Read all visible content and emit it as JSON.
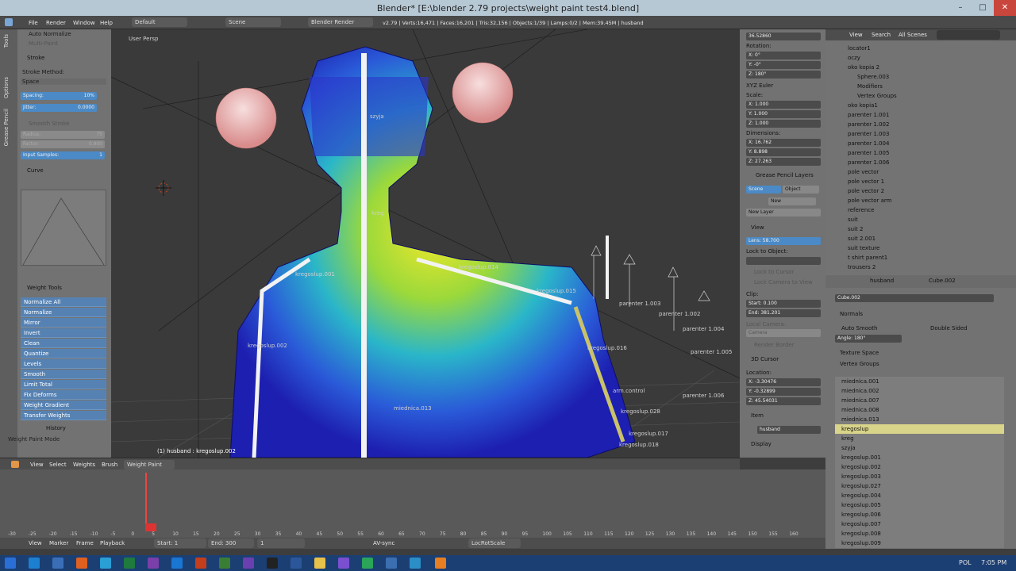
{
  "window": {
    "title": "Blender* [E:\\blender 2.79 projects\\weight paint test4.blend]",
    "min": "–",
    "max": "□",
    "close": "✕"
  },
  "infobar": {
    "menus": [
      "File",
      "Render",
      "Window",
      "Help"
    ],
    "layout": "Default",
    "scene": "Scene",
    "engine": "Blender Render",
    "stats": "v2.79 | Verts:16,471 | Faces:16,201 | Tris:32,156 | Objects:1/39 | Lamps:0/2 | Mem:39.45M | husband"
  },
  "lefttabs": [
    "Tools",
    "Options",
    "Grease Pencil"
  ],
  "toolshelf": {
    "auto_normalize": "Auto Normalize",
    "multi_paint": "Multi-Paint",
    "stroke": "Stroke",
    "stroke_method_label": "Stroke Method:",
    "stroke_method": "Space",
    "spacing": "Spacing:",
    "spacing_val": "10%",
    "jitter": "Jitter:",
    "jitter_val": "0.0000",
    "smooth_stroke": "Smooth Stroke",
    "radius": "Radius:",
    "radius_val": "75",
    "factor": "Factor:",
    "factor_val": "0.900",
    "input_samples": "Input Samples:",
    "input_samples_val": "1",
    "curve": "Curve",
    "weight_tools": "Weight Tools",
    "tools": [
      "Normalize All",
      "Normalize",
      "Mirror",
      "Invert",
      "Clean",
      "Quantize",
      "Levels",
      "Smooth",
      "Limit Total",
      "Fix Deforms",
      "Weight Gradient",
      "Transfer Weights"
    ],
    "history": "History",
    "mode_label": "Weight Paint Mode"
  },
  "viewport": {
    "view_label": "User Persp",
    "object_label": "(1) husband : kregoslup.002",
    "bone_labels": [
      "szyja",
      "kreg",
      "kregoslup.001",
      "kregoslup.014",
      "kregoslup.015",
      "kregoslup.016",
      "kregoslup.002",
      "miednica.013",
      "arm.control",
      "kregoslup.028",
      "kregoslup.017",
      "kregoslup.018",
      "parenter 1.003",
      "parenter 1.002",
      "parenter 1.004",
      "parenter 1.005",
      "parenter 1.006"
    ]
  },
  "viewhdr": {
    "items": [
      "View",
      "Select",
      "Weights",
      "Brush"
    ],
    "mode": "Weight Paint"
  },
  "props": {
    "z_loc": "36.52860",
    "rotation": "Rotation:",
    "rot": [
      "X: 0°",
      "Y: -0°",
      "Z: 180°"
    ],
    "euler": "XYZ Euler",
    "scale": "Scale:",
    "scl": [
      "X: 1.000",
      "Y: 1.000",
      "Z: 1.000"
    ],
    "dimensions": "Dimensions:",
    "dim": [
      "X: 16.762",
      "Y: 8.898",
      "Z: 27.263"
    ],
    "gp_layers": "Grease Pencil Layers",
    "scene_tab": "Scene",
    "object_tab": "Object",
    "new": "New",
    "new_layer": "New Layer",
    "view": "View",
    "lens": "Lens: 58.700",
    "lock_to_object": "Lock to Object:",
    "lock_to_cursor": "Lock to Cursor",
    "lock_camera": "Lock Camera to View",
    "clip": "Clip:",
    "clip_start": "Start: 0.100",
    "clip_end": "End: 381.201",
    "local_camera": "Local Camera:",
    "camera": "Camera",
    "render_border": "Render Border",
    "cursor3d": "3D Cursor",
    "location": "Location:",
    "loc": [
      "X: -3.30476",
      "Y: -0.32899",
      "Z: 45.54031"
    ],
    "item": "Item",
    "item_name": "husband",
    "display": "Display"
  },
  "outliner": {
    "menus": [
      "View",
      "Search",
      "All Scenes"
    ],
    "rows": [
      "locator1",
      "oczy",
      "oko kopia 2",
      "Sphere.003",
      "Modifiers",
      "Vertex Groups",
      "oko kopia1",
      "parenter 1.001",
      "parenter 1.002",
      "parenter 1.003",
      "parenter 1.004",
      "parenter 1.005",
      "parenter 1.006",
      "pole vector",
      "pole vector 1",
      "pole vector 2",
      "pole vector arm",
      "reference",
      "suit",
      "suit 2",
      "suit 2.001",
      "suit texture",
      "t shirt parent1",
      "trousers 2"
    ]
  },
  "props2": {
    "breadcrumb": [
      "husband",
      "Cube.002"
    ],
    "mesh_name": "Cube.002",
    "normals": "Normals",
    "auto_smooth": "Auto Smooth",
    "double_sided": "Double Sided",
    "angle": "Angle: 180°",
    "texture_space": "Texture Space",
    "vertex_groups": "Vertex Groups",
    "groups": [
      "miednica.001",
      "miednica.002",
      "miednica.007",
      "miednica.008",
      "miednica.013",
      "kregoslup",
      "kreg",
      "szyja",
      "kregoslup.001",
      "kregoslup.002",
      "kregoslup.003",
      "kregoslup.027",
      "kregoslup.004",
      "kregoslup.005",
      "kregoslup.006",
      "kregoslup.007",
      "kregoslup.008",
      "kregoslup.009"
    ]
  },
  "timeline": {
    "ticks": [
      "-30",
      "-25",
      "-20",
      "-15",
      "-10",
      "-5",
      "0",
      "5",
      "10",
      "15",
      "20",
      "25",
      "30",
      "35",
      "40",
      "45",
      "50",
      "55",
      "60",
      "65",
      "70",
      "75",
      "80",
      "85",
      "90",
      "95",
      "100",
      "105",
      "110",
      "115",
      "120",
      "125",
      "130",
      "135",
      "140",
      "145",
      "150",
      "155",
      "160"
    ],
    "menus": [
      "View",
      "Marker",
      "Frame",
      "Playback"
    ],
    "start": "Start:",
    "start_val": "1",
    "end": "End:",
    "end_val": "300",
    "current": "1",
    "sync": "AV-sync",
    "keyset": "LocRotScale"
  },
  "taskbar": {
    "lang": "POL",
    "time": "7:05 PM"
  }
}
